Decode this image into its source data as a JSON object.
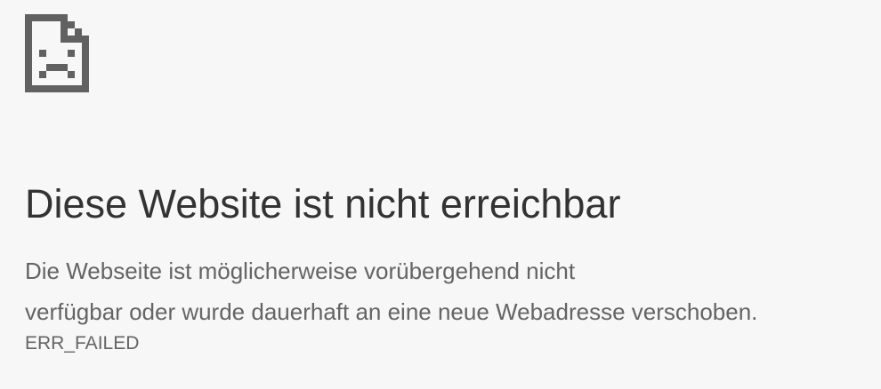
{
  "error_icon": {
    "icon_name": "sad-document-icon",
    "color": "#616161"
  },
  "heading": "Diese Website ist nicht erreichbar",
  "message": "Die Webseite  ist möglicherweise vorübergehend nicht\nverfügbar oder wurde dauerhaft an eine neue Webadresse verschoben.",
  "error_code": "ERR_FAILED",
  "colors": {
    "background": "#f7f7f7",
    "heading": "#333333",
    "body_text": "#646464"
  }
}
